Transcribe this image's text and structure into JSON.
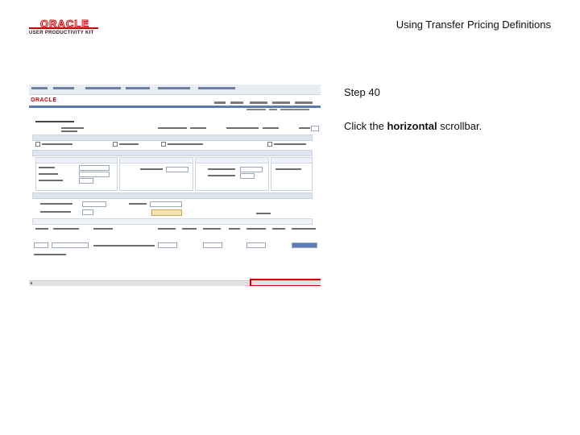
{
  "header": {
    "logo_word": "ORACLE",
    "logo_sub": "USER PRODUCTIVITY KIT",
    "title": "Using Transfer Pricing Definitions"
  },
  "screenshot": {
    "brand": "ORACLE"
  },
  "step": {
    "label": "Step 40",
    "instruction_prefix": "Click the ",
    "instruction_bold": "horizontal",
    "instruction_suffix": " scrollbar."
  },
  "colors": {
    "highlight": "#d60000",
    "oracle_red": "#cc0000",
    "nav_blue": "#5b7bb0"
  }
}
